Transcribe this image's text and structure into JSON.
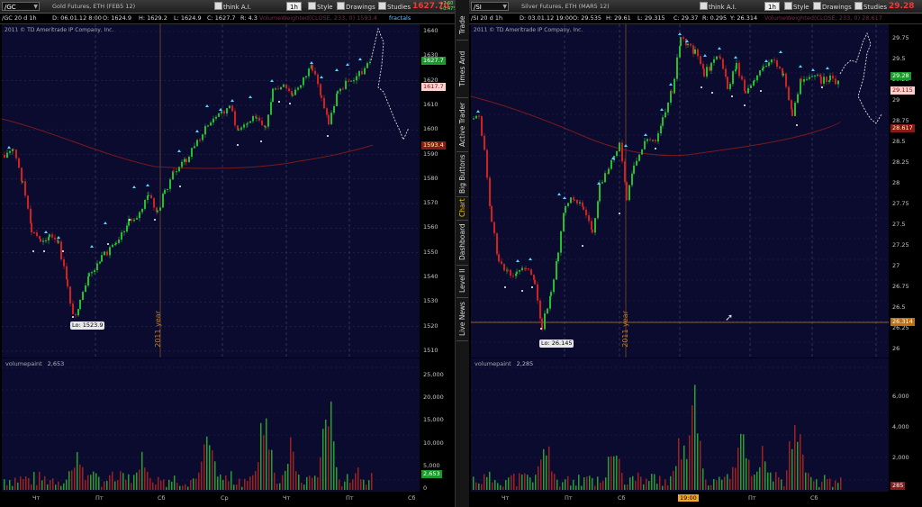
{
  "left": {
    "symbol": "/GC",
    "description": "Gold Futures, ETH (FEB5 12)",
    "think_label": "think A.I.",
    "timeframe": "1h",
    "style_label": "Style",
    "drawings_label": "Drawings",
    "studies_label": "Studies",
    "last_price": "1627.70",
    "change_abs": "+7.60",
    "change_pct": "+0.47%",
    "info": {
      "range": "/GC 20 d 1h",
      "date": "D: 06.01.12 8:00",
      "open": "O: 1624.9",
      "high": "H: 1629.2",
      "low": "L: 1624.9",
      "close": "C: 1627.7",
      "r": "R: 4.3",
      "study_text": "VolumeWeighted(CLOSE, 233, 0)  1593.4",
      "fractals": "fractals"
    },
    "copyright": "2011 © TD Ameritrade IP Company, Inc.",
    "price_axis": [
      "1640",
      "1630",
      "1620",
      "1610",
      "1600",
      "1590",
      "1580",
      "1570",
      "1560",
      "1550",
      "1540",
      "1530",
      "1520",
      "1510"
    ],
    "price_tags": {
      "green": "1627.7",
      "pink": "1617.7",
      "red": "1593.4"
    },
    "lo_label": "Lo: 1523.9",
    "year_label": "2011 year",
    "volume_title": "volumepaint",
    "volume_value": "2,653",
    "volume_axis": [
      "25,000",
      "20,000",
      "15,000",
      "10,000",
      "5,000",
      "0"
    ],
    "volume_tag": "2,653",
    "days": [
      "Чт",
      "Пт",
      "Сб",
      "Ср",
      "Чт",
      "Пт",
      "Сб"
    ]
  },
  "right": {
    "symbol": "/SI",
    "description": "Silver Futures, ETH (MAR5 12)",
    "think_label": "think A.I.",
    "timeframe": "1h",
    "style_label": "Style",
    "drawings_label": "Drawings",
    "studies_label": "Studies",
    "last_price": "29.28",
    "info": {
      "range": "/SI 20 d 1h",
      "date": "D: 03.01.12 19:00",
      "open": "O: 29.535",
      "high": "H: 29.61",
      "low": "L: 29.315",
      "close": "C: 29.37",
      "r": "R: 0.295",
      "y": "Y: 26.314",
      "study_text": "VolumeWeighted(CLOSE, 233, 0)  28.617"
    },
    "copyright": "2011 © TD Ameritrade IP Company, Inc.",
    "price_axis": [
      "29.75",
      "29.5",
      "29.25",
      "29",
      "28.75",
      "28.5",
      "28.25",
      "28",
      "27.75",
      "27.5",
      "27.25",
      "27",
      "26.75",
      "26.5",
      "26.25",
      "26"
    ],
    "price_tags": {
      "green": "29.28",
      "pink": "29.115",
      "red": "28.617",
      "orange": "26.314"
    },
    "lo_label": "Lo: 26.145",
    "year_label": "2011 year",
    "volume_title": "volumepaint",
    "volume_value": "2,285",
    "volume_axis": [
      "6,000",
      "4,000",
      "2,000"
    ],
    "volume_tag": "285",
    "days": [
      "Чт",
      "Пт",
      "Сб",
      "19:00",
      "Пт",
      "Сб"
    ]
  },
  "sidetabs": [
    "Trade",
    "Times And Sales",
    "Active Trader",
    "Big Buttons",
    "Chart",
    "Dashboard",
    "Level II",
    "Live News"
  ],
  "active_tab": "Chart",
  "colors": {
    "chart_bg": "#0b0b30",
    "up": "#22c030",
    "down": "#d02020",
    "vwap": "#8a2020",
    "accent": "#f5c518"
  }
}
